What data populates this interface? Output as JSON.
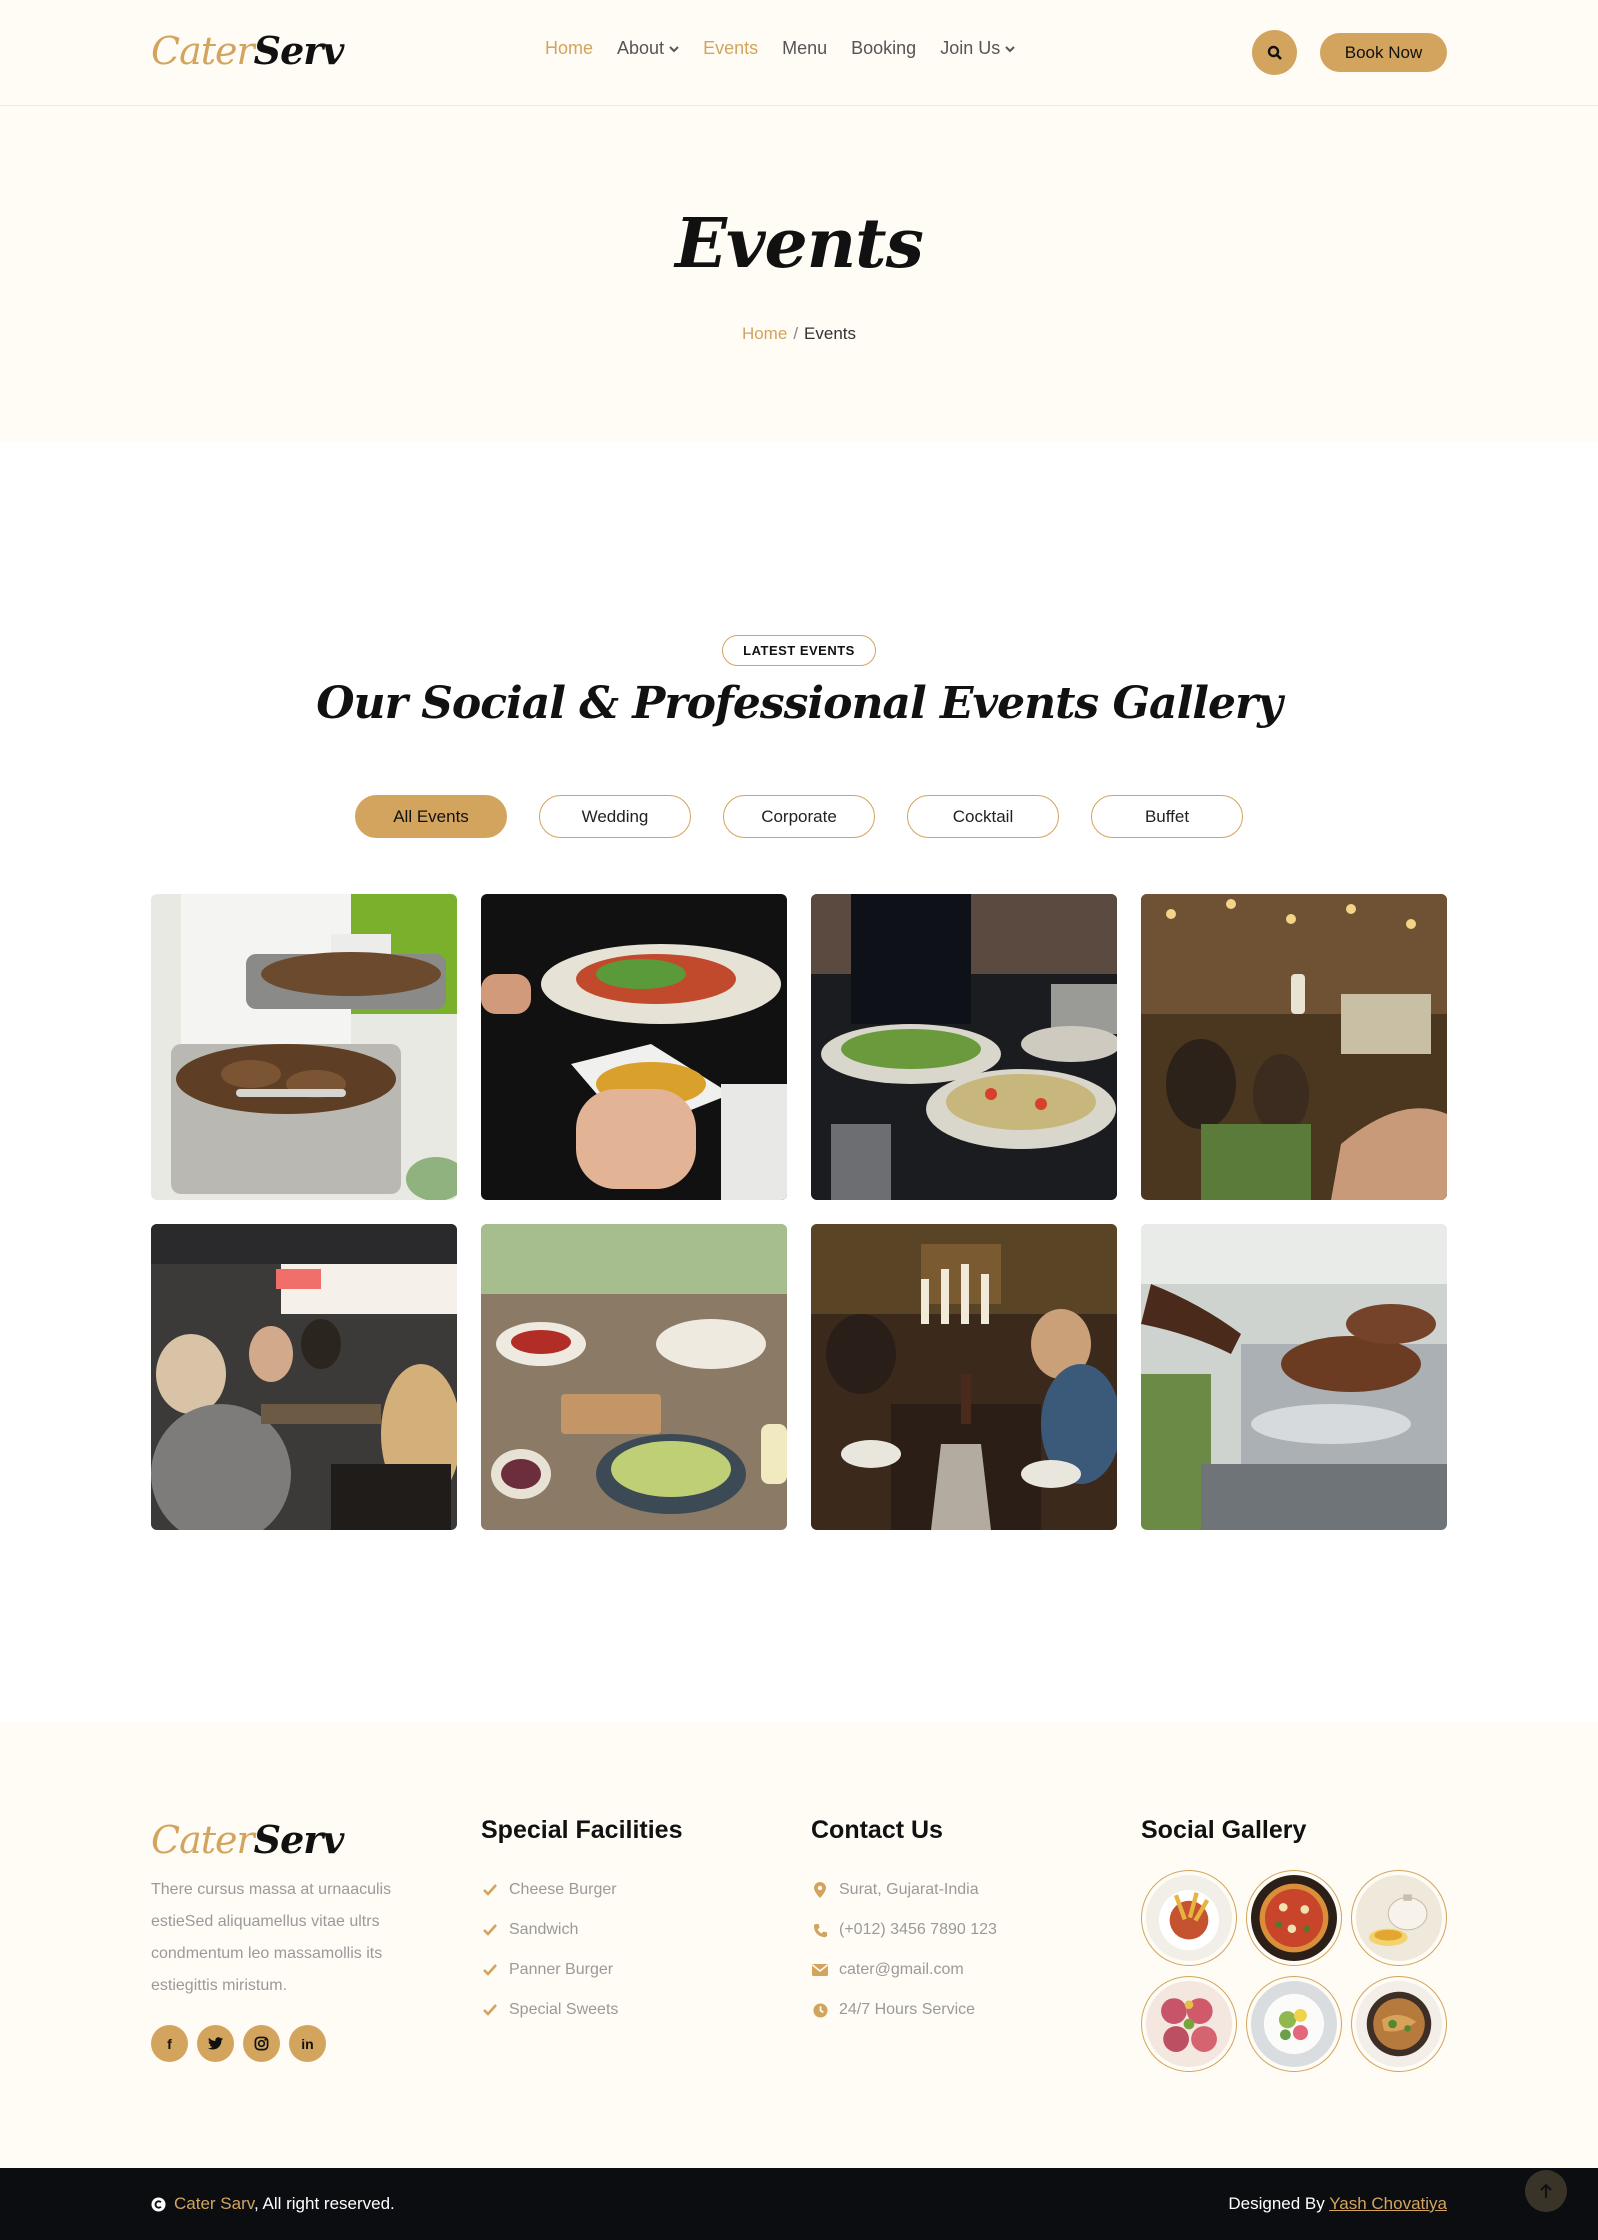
{
  "brand": {
    "part1": "Cater",
    "part2": "Serv"
  },
  "header": {
    "nav": [
      {
        "label": "Home",
        "active": true,
        "dropdown": false
      },
      {
        "label": "About",
        "active": false,
        "dropdown": true
      },
      {
        "label": "Events",
        "active": true,
        "dropdown": false
      },
      {
        "label": "Menu",
        "active": false,
        "dropdown": false
      },
      {
        "label": "Booking",
        "active": false,
        "dropdown": false
      },
      {
        "label": "Join Us",
        "active": false,
        "dropdown": true
      }
    ],
    "search_icon": "search-icon",
    "cta_label": "Book Now"
  },
  "hero": {
    "title": "Events",
    "breadcrumb": {
      "home": "Home",
      "separator": "/",
      "current": "Events"
    }
  },
  "events": {
    "badge": "LATEST EVENTS",
    "title": "Our Social & Professional Events Gallery",
    "filters": [
      "All Events",
      "Wedding",
      "Corporate",
      "Cocktail",
      "Buffet"
    ],
    "active_filter": "All Events",
    "gallery": [
      {
        "alt": "grilled-chicken-chafing-dish"
      },
      {
        "alt": "salad-plate-serving"
      },
      {
        "alt": "waiter-serving-salad-bowls"
      },
      {
        "alt": "party-guests-toasting"
      },
      {
        "alt": "friends-dining-outdoors"
      },
      {
        "alt": "appetizer-table-spread"
      },
      {
        "alt": "candlelit-dinner-toast"
      },
      {
        "alt": "chef-grilling-meat"
      }
    ]
  },
  "footer": {
    "description": "There cursus massa at urnaaculis estieSed aliquamellus vitae ultrs condmentum leo massamollis its estiegittis miristum.",
    "socials": [
      {
        "icon": "facebook-icon",
        "glyph": "f"
      },
      {
        "icon": "twitter-icon",
        "glyph": "t"
      },
      {
        "icon": "instagram-icon",
        "glyph": "◎"
      },
      {
        "icon": "linkedin-icon",
        "glyph": "in"
      }
    ],
    "facilities": {
      "title": "Special Facilities",
      "items": [
        "Cheese Burger",
        "Sandwich",
        "Panner Burger",
        "Special Sweets"
      ]
    },
    "contact": {
      "title": "Contact Us",
      "items": [
        {
          "icon": "map-pin-icon",
          "text": "Surat, Gujarat-India"
        },
        {
          "icon": "phone-icon",
          "text": "(+012) 3456 7890 123"
        },
        {
          "icon": "envelope-icon",
          "text": "cater@gmail.com"
        },
        {
          "icon": "clock-icon",
          "text": "24/7 Hours Service"
        }
      ]
    },
    "social_gallery": {
      "title": "Social Gallery",
      "items": [
        "fries-dish",
        "pizza",
        "tea-pot",
        "salami-plate",
        "salad-plate",
        "noodle-bowl"
      ]
    }
  },
  "copyright": {
    "brand": "Cater Sarv",
    "text": ", All right reserved.",
    "designed_by": "Designed By",
    "designer": "Yash Chovatiya"
  },
  "colors": {
    "accent": "#d2a45e",
    "cream": "#fffbf5",
    "dark": "#0c0d10"
  }
}
